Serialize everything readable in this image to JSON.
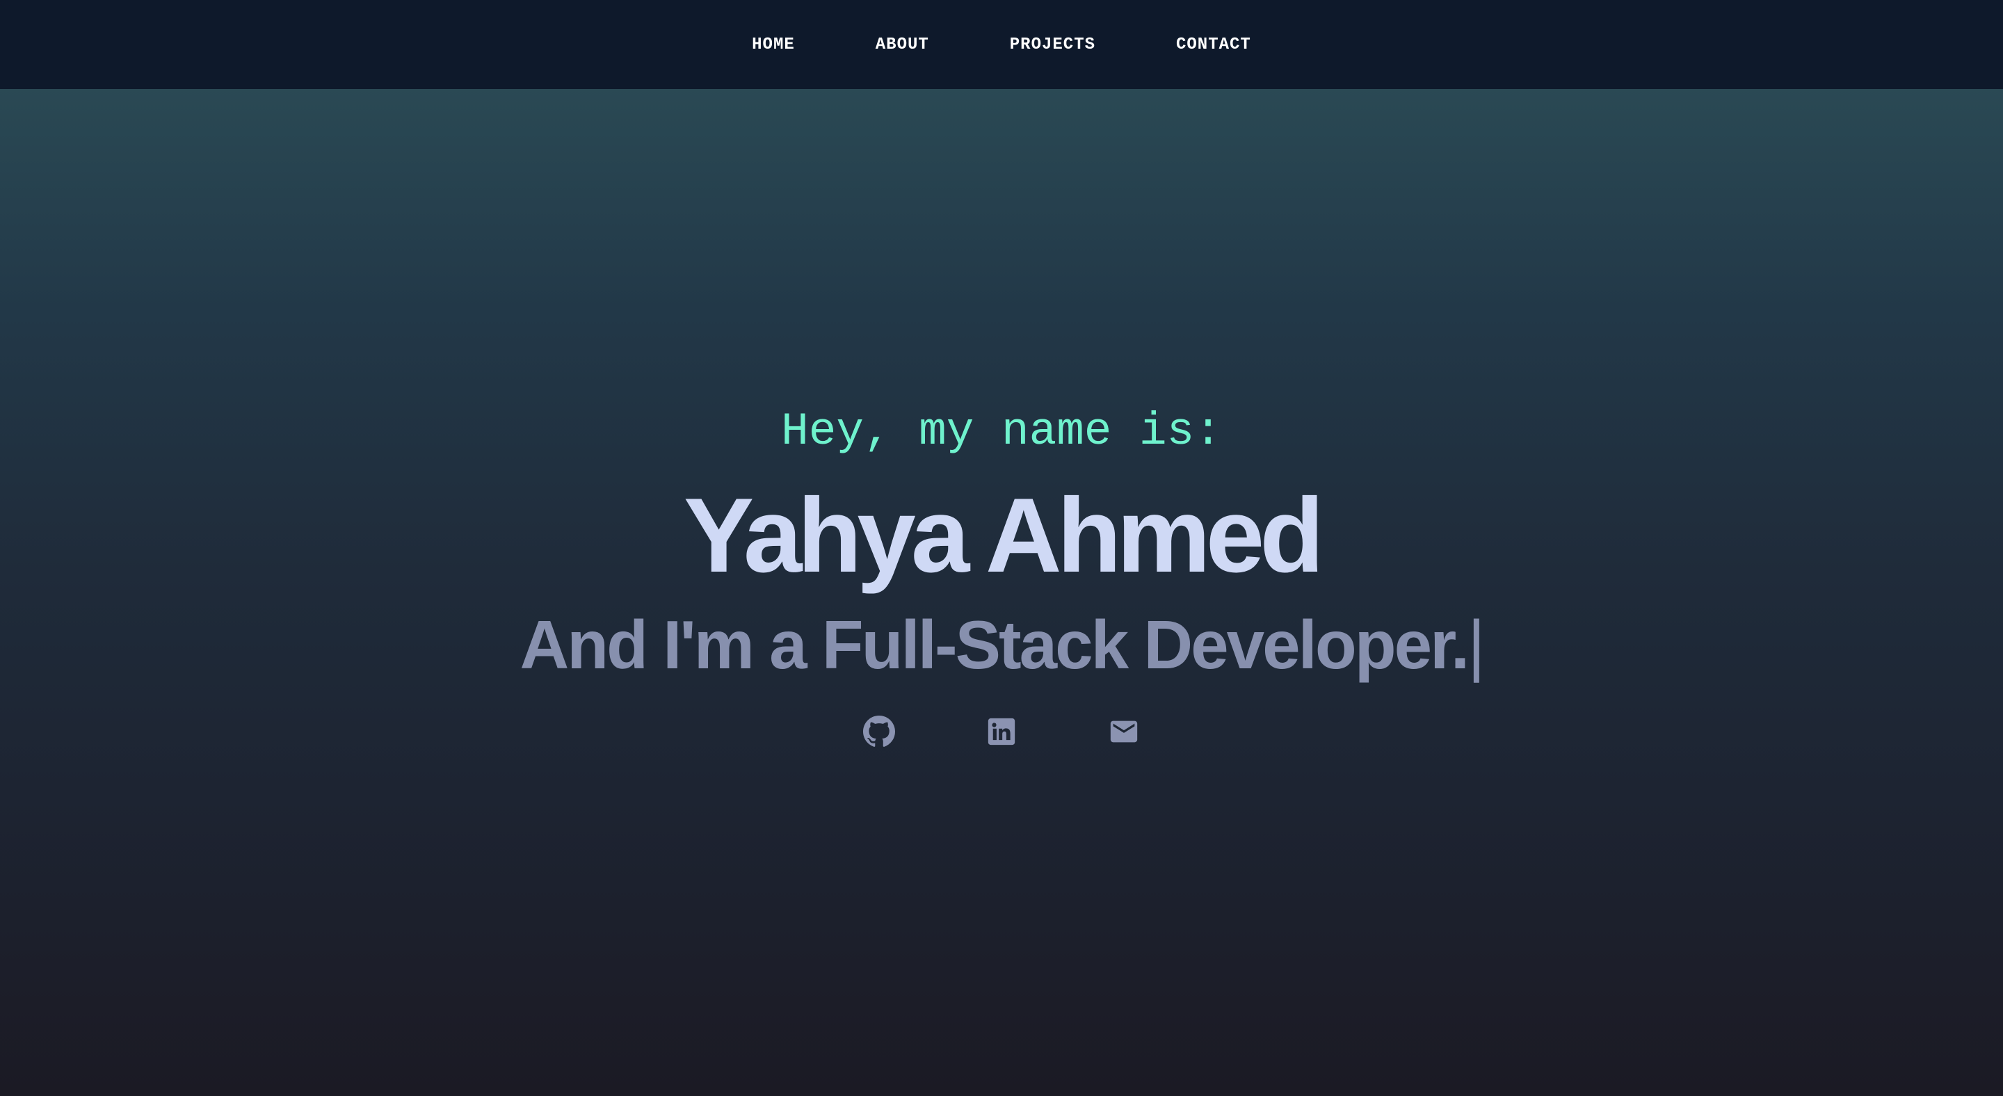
{
  "nav": {
    "items": [
      {
        "label": "HOME"
      },
      {
        "label": "ABOUT"
      },
      {
        "label": "PROJECTS"
      },
      {
        "label": "CONTACT"
      }
    ]
  },
  "hero": {
    "greeting": "Hey, my name is:",
    "name": "Yahya Ahmed",
    "tagline": "And I'm a Full-Stack Developer.",
    "cursor": "|"
  },
  "socials": [
    {
      "icon": "github-icon"
    },
    {
      "icon": "linkedin-icon"
    },
    {
      "icon": "mail-icon"
    }
  ],
  "colors": {
    "nav_bg": "#0e192b",
    "greeting": "#6ff2cd",
    "name": "#cfd9f5",
    "tagline": "#8790ae",
    "icons": "#8b93b1"
  }
}
